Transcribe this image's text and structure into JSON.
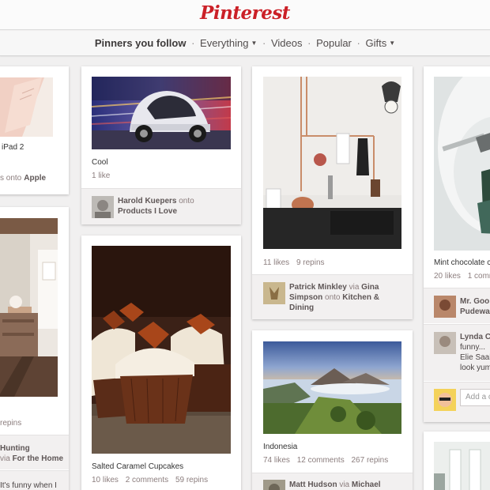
{
  "header": {
    "logo_text": "Pinterest"
  },
  "nav": {
    "pinners_you_follow": "Pinners you follow",
    "everything": "Everything",
    "videos": "Videos",
    "popular": "Popular",
    "gifts": "Gifts"
  },
  "pins": {
    "ipad": {
      "description": "iPad 2",
      "repinned_prefix": "s onto",
      "board": "Apple"
    },
    "cool": {
      "description": "Cool",
      "likes": "1 like",
      "user": "Harold Kuepers",
      "onto": "onto",
      "board": "Products I Love"
    },
    "kitchen": {
      "likes": "11 likes",
      "repins": "9 repins",
      "user": "Patrick Minkley",
      "via": "via",
      "via_user": "Gina Simpson",
      "onto": "onto",
      "board": "Kitchen & Dining"
    },
    "mint": {
      "description": "Mint chocolate c",
      "likes": "20 likes",
      "comments": "1 comm",
      "user_line1": "Mr. Goo",
      "user_line2": "Pudewa"
    },
    "lynda": {
      "name": "Lynda C",
      "line1": "funny...",
      "line2": "Elie Saab",
      "line3": "look yum"
    },
    "interior": {
      "repins": "repins",
      "user": "Hunting",
      "via": "via",
      "board_prefix": "For the Home",
      "comment": "It's funny when I"
    },
    "cupcakes": {
      "description": "Salted Caramel Cupcakes",
      "likes": "10 likes",
      "comments": "2 comments",
      "repins": "59 repins"
    },
    "indonesia": {
      "description": "Indonesia",
      "likes": "74 likes",
      "comments": "12 comments",
      "repins": "267 repins",
      "user": "Matt Hudson",
      "via": "via",
      "via_user": "Michael"
    }
  },
  "add_comment_placeholder": "Add a co",
  "colors": {
    "brand": "#cb2027",
    "background": "#f1f0f0",
    "attribution_bg": "#f2f0f0"
  }
}
